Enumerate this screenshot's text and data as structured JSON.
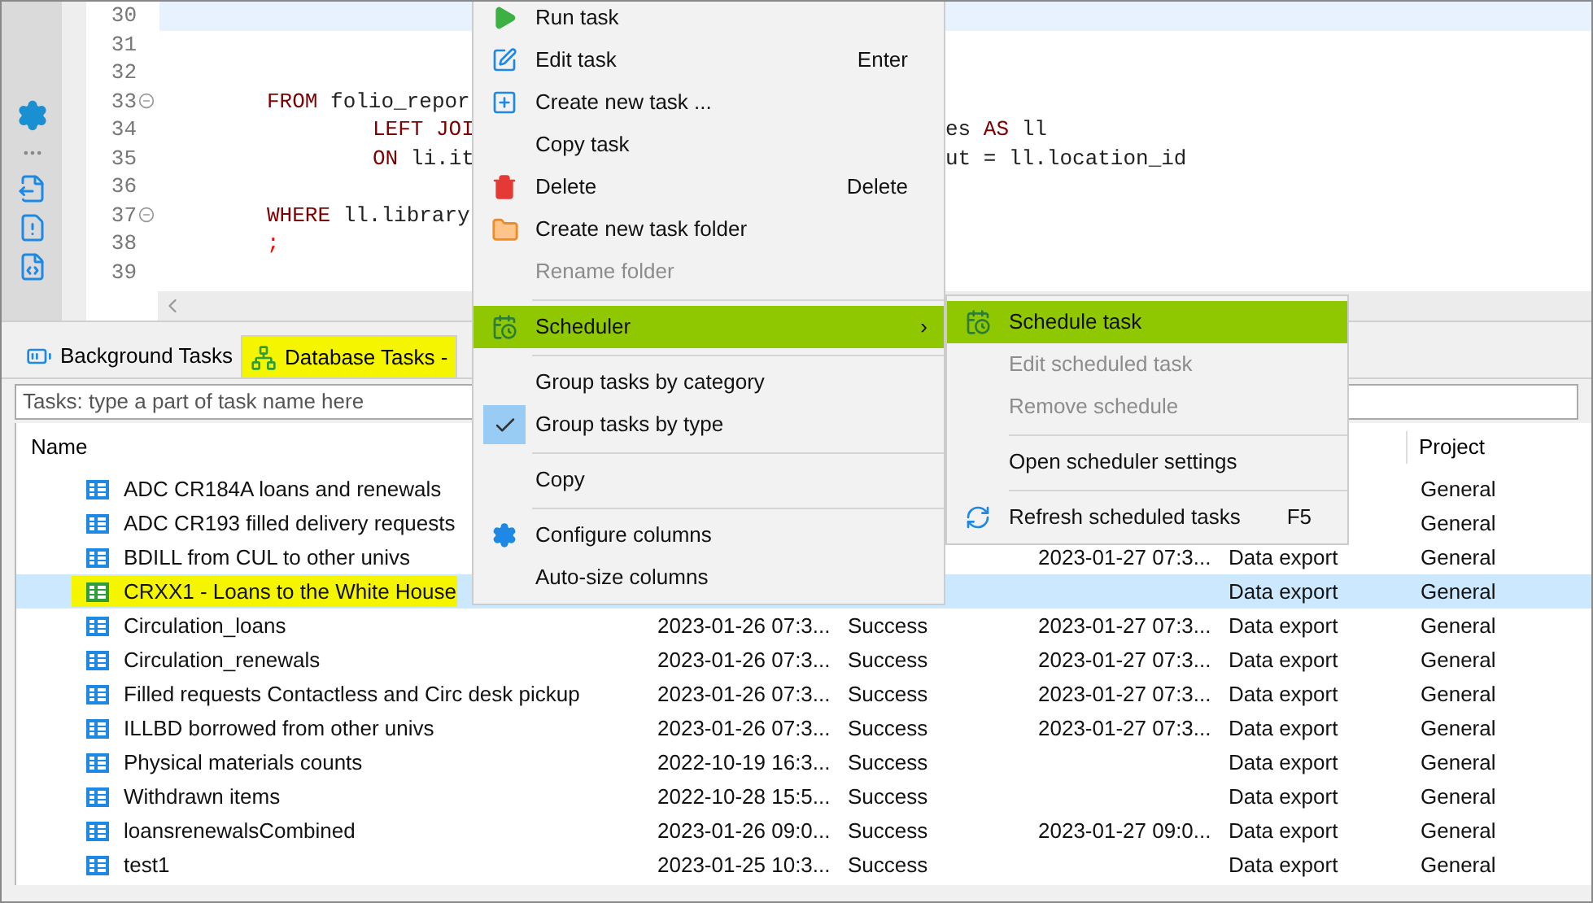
{
  "editor": {
    "lines": [
      {
        "number": "30",
        "foldable": false,
        "current": true
      },
      {
        "number": "31",
        "foldable": false,
        "current": false
      },
      {
        "number": "32",
        "foldable": false,
        "current": false
      },
      {
        "number": "33",
        "foldable": true,
        "current": false,
        "indented": false,
        "left": [
          {
            "kind": "keyword",
            "text": "FROM"
          },
          {
            "kind": "plain",
            "text": "folio_repor"
          }
        ]
      },
      {
        "number": "34",
        "foldable": false,
        "current": false,
        "indented": true,
        "left": [
          {
            "kind": "keyword",
            "text": "LEFT JOI"
          }
        ],
        "right": [
          {
            "kind": "plain",
            "text": "es"
          },
          {
            "kind": "keyword",
            "text": "AS"
          },
          {
            "kind": "plain",
            "text": "ll"
          }
        ]
      },
      {
        "number": "35",
        "foldable": false,
        "current": false,
        "indented": true,
        "left": [
          {
            "kind": "keyword",
            "text": "ON"
          },
          {
            "kind": "plain",
            "text": "li.it"
          }
        ],
        "right": [
          {
            "kind": "plain",
            "text": "ut = ll.location_id"
          }
        ]
      },
      {
        "number": "36",
        "foldable": false,
        "current": false
      },
      {
        "number": "37",
        "foldable": true,
        "current": false,
        "indented": false,
        "left": [
          {
            "kind": "keyword",
            "text": "WHERE"
          },
          {
            "kind": "plain",
            "text": "ll.library"
          }
        ]
      },
      {
        "number": "38",
        "foldable": false,
        "current": false,
        "indented": false,
        "left": [
          {
            "kind": "punct",
            "text": ";"
          }
        ]
      },
      {
        "number": "39",
        "foldable": false,
        "current": false
      }
    ]
  },
  "tabs": [
    {
      "label": "Background Tasks",
      "selected": false,
      "highlighted": false
    },
    {
      "label": "Database Tasks -",
      "selected": true,
      "highlighted": true
    }
  ],
  "filter": {
    "placeholder": "Tasks: type a part of task name here"
  },
  "table": {
    "columns": [
      "Name",
      "Project"
    ],
    "rows": [
      {
        "name": "ADC CR184A loans and renewals",
        "project": "General",
        "selected": false,
        "highlighted": false
      },
      {
        "name": "ADC CR193 filled delivery requests",
        "project": "General",
        "selected": false,
        "highlighted": false
      },
      {
        "name": "BDILL from CUL to other univs",
        "column_4": "2023-01-27 07:3...",
        "column_5": "Data export",
        "project": "General",
        "selected": false,
        "highlighted": false
      },
      {
        "name": "CRXX1 - Loans to the White House",
        "column_5": "Data export",
        "project": "General",
        "selected": true,
        "highlighted": true
      },
      {
        "name": "Circulation_loans",
        "column_2": "2023-01-26 07:3...",
        "column_3": "Success",
        "column_4": "2023-01-27 07:3...",
        "column_5": "Data export",
        "project": "General",
        "selected": false,
        "highlighted": false
      },
      {
        "name": "Circulation_renewals",
        "column_2": "2023-01-26 07:3...",
        "column_3": "Success",
        "column_4": "2023-01-27 07:3...",
        "column_5": "Data export",
        "project": "General",
        "selected": false,
        "highlighted": false
      },
      {
        "name": "Filled requests Contactless and Circ desk pickup",
        "column_2": "2023-01-26 07:3...",
        "column_3": "Success",
        "column_4": "2023-01-27 07:3...",
        "column_5": "Data export",
        "project": "General",
        "selected": false,
        "highlighted": false
      },
      {
        "name": "ILLBD borrowed from other univs",
        "column_2": "2023-01-26 07:3...",
        "column_3": "Success",
        "column_4": "2023-01-27 07:3...",
        "column_5": "Data export",
        "project": "General",
        "selected": false,
        "highlighted": false
      },
      {
        "name": "Physical materials counts",
        "column_2": "2022-10-19 16:3...",
        "column_3": "Success",
        "column_5": "Data export",
        "project": "General",
        "selected": false,
        "highlighted": false
      },
      {
        "name": "Withdrawn items",
        "column_2": "2022-10-28 15:5...",
        "column_3": "Success",
        "column_5": "Data export",
        "project": "General",
        "selected": false,
        "highlighted": false
      },
      {
        "name": "loansrenewalsCombined",
        "column_2": "2023-01-26 09:0...",
        "column_3": "Success",
        "column_4": "2023-01-27 09:0...",
        "column_5": "Data export",
        "project": "General",
        "selected": false,
        "highlighted": false
      },
      {
        "name": "test1",
        "column_2": "2023-01-25 10:3...",
        "column_3": "Success",
        "column_5": "Data export",
        "project": "General",
        "selected": false,
        "highlighted": false
      }
    ]
  },
  "context_menu": {
    "items": [
      {
        "kind": "item",
        "label": "Run task",
        "disabled": false,
        "selected": false,
        "checked": false
      },
      {
        "kind": "item",
        "label": "Edit task",
        "shortcut": "Enter",
        "disabled": false,
        "selected": false,
        "checked": false
      },
      {
        "kind": "item",
        "label": "Create new task ...",
        "disabled": false,
        "selected": false,
        "checked": false
      },
      {
        "kind": "item",
        "label": "Copy task",
        "disabled": false,
        "selected": false,
        "checked": false
      },
      {
        "kind": "item",
        "label": "Delete",
        "shortcut": "Delete",
        "disabled": false,
        "selected": false,
        "checked": false
      },
      {
        "kind": "item",
        "label": "Create new task folder",
        "disabled": false,
        "selected": false,
        "checked": false
      },
      {
        "kind": "item",
        "label": "Rename folder",
        "disabled": true,
        "selected": false,
        "checked": false
      },
      {
        "kind": "separator"
      },
      {
        "kind": "submenu",
        "label": "Scheduler",
        "arrow": "›",
        "disabled": false,
        "selected": true,
        "checked": false
      },
      {
        "kind": "separator"
      },
      {
        "kind": "item",
        "label": "Group tasks by category",
        "disabled": false,
        "selected": false,
        "checked": false
      },
      {
        "kind": "item",
        "label": "Group tasks by type",
        "disabled": false,
        "selected": false,
        "checked": true
      },
      {
        "kind": "separator"
      },
      {
        "kind": "item",
        "label": "Copy",
        "disabled": false,
        "selected": false,
        "checked": false
      },
      {
        "kind": "separator"
      },
      {
        "kind": "item",
        "label": "Configure columns",
        "disabled": false,
        "selected": false,
        "checked": false
      },
      {
        "kind": "item",
        "label": "Auto-size columns",
        "disabled": false,
        "selected": false,
        "checked": false
      }
    ]
  },
  "submenu": {
    "items": [
      {
        "kind": "item",
        "label": "Schedule task",
        "disabled": false,
        "selected": true
      },
      {
        "kind": "item",
        "label": "Edit scheduled task",
        "disabled": true,
        "selected": false
      },
      {
        "kind": "item",
        "label": "Remove schedule",
        "disabled": true,
        "selected": false
      },
      {
        "kind": "separator"
      },
      {
        "kind": "item",
        "label": "Open scheduler settings",
        "disabled": false,
        "selected": false
      },
      {
        "kind": "separator"
      },
      {
        "kind": "item",
        "label": "Refresh scheduled tasks",
        "shortcut": "F5",
        "disabled": false,
        "selected": false
      }
    ]
  }
}
